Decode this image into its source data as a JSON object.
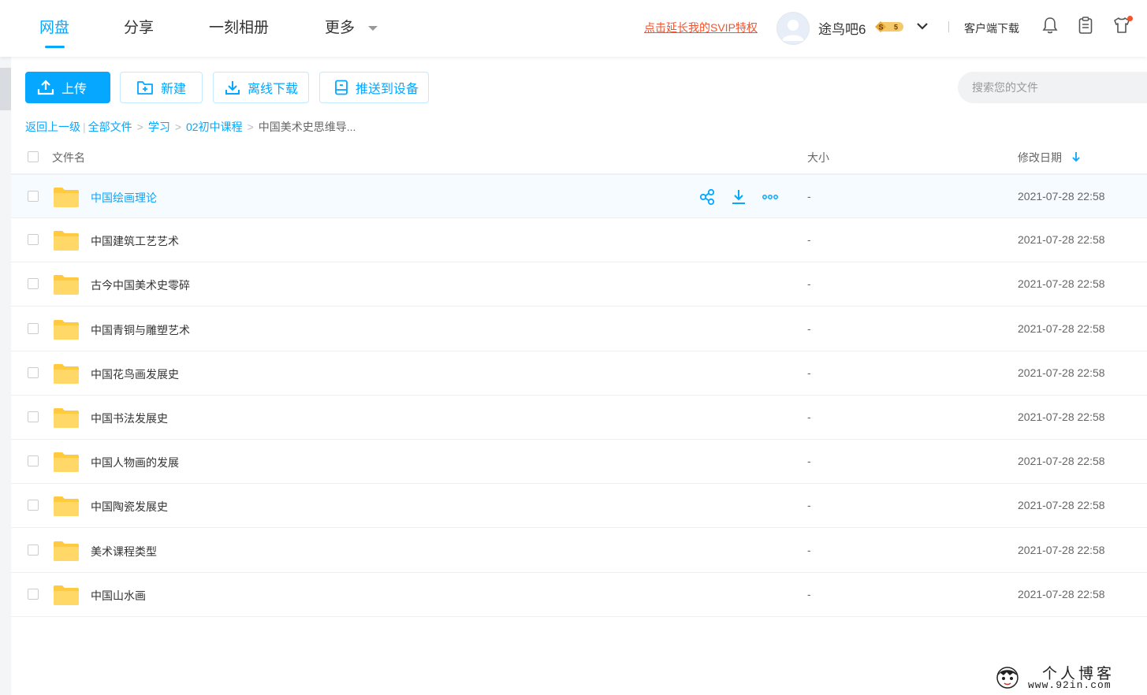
{
  "nav": {
    "tabs": [
      "网盘",
      "分享",
      "一刻相册",
      "更多"
    ],
    "svip_link": "点击延长我的SVIP特权",
    "username": "途鸟吧6",
    "client_download": "客户端下载"
  },
  "toolbar": {
    "upload": "上传",
    "new": "新建",
    "offline_download": "离线下载",
    "push_to_device": "推送到设备",
    "search_placeholder": "搜索您的文件"
  },
  "breadcrumb": {
    "back": "返回上一级",
    "items": [
      "全部文件",
      "学习",
      "02初中课程"
    ],
    "current": "中国美术史思维导..."
  },
  "table": {
    "headers": {
      "name": "文件名",
      "size": "大小",
      "date": "修改日期"
    },
    "rows": [
      {
        "name": "中国绘画理论",
        "size": "-",
        "date": "2021-07-28 22:58"
      },
      {
        "name": "中国建筑工艺艺术",
        "size": "-",
        "date": "2021-07-28 22:58"
      },
      {
        "name": "古今中国美术史零碎",
        "size": "-",
        "date": "2021-07-28 22:58"
      },
      {
        "name": "中国青铜与雕塑艺术",
        "size": "-",
        "date": "2021-07-28 22:58"
      },
      {
        "name": "中国花鸟画发展史",
        "size": "-",
        "date": "2021-07-28 22:58"
      },
      {
        "name": "中国书法发展史",
        "size": "-",
        "date": "2021-07-28 22:58"
      },
      {
        "name": "中国人物画的发展",
        "size": "-",
        "date": "2021-07-28 22:58"
      },
      {
        "name": "中国陶瓷发展史",
        "size": "-",
        "date": "2021-07-28 22:58"
      },
      {
        "name": "美术课程类型",
        "size": "-",
        "date": "2021-07-28 22:58"
      },
      {
        "name": "中国山水画",
        "size": "-",
        "date": "2021-07-28 22:58"
      }
    ]
  },
  "watermark": {
    "title": "个人博客",
    "url": "www.92in.com"
  },
  "colors": {
    "accent": "#06a7ff",
    "svip": "#f2522d",
    "folder": "#ffd25e"
  }
}
